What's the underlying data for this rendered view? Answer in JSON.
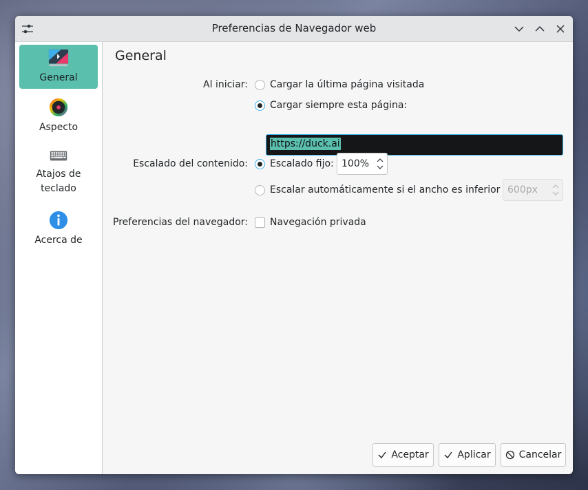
{
  "window": {
    "title": "Preferencias de Navegador web"
  },
  "sidebar": {
    "items": [
      {
        "label": "General",
        "icon": "general-icon",
        "active": true
      },
      {
        "label": "Aspecto",
        "icon": "color-wheel-icon"
      },
      {
        "label": "Atajos de teclado",
        "icon": "keyboard-icon"
      },
      {
        "label": "Acerca de",
        "icon": "info-icon"
      }
    ]
  },
  "general": {
    "heading": "General",
    "startup": {
      "label": "Al iniciar:",
      "option_last": "Cargar la última página visitada",
      "option_always": "Cargar siempre esta página:",
      "selected": "always",
      "url": "https://duck.ai"
    },
    "scaling": {
      "label": "Escalado del contenido:",
      "option_fixed": "Escalado fijo:",
      "fixed_value": "100%",
      "option_auto": "Escalar automáticamente si el ancho es inferior",
      "auto_value": "600px",
      "selected": "fixed"
    },
    "browser": {
      "label": "Preferencias del navegador:",
      "private_label": "Navegación privada",
      "private_checked": false
    }
  },
  "buttons": {
    "accept": "Aceptar",
    "apply": "Aplicar",
    "cancel": "Cancelar"
  },
  "colors": {
    "accent": "#5bbfae",
    "focus": "#3daee9"
  }
}
